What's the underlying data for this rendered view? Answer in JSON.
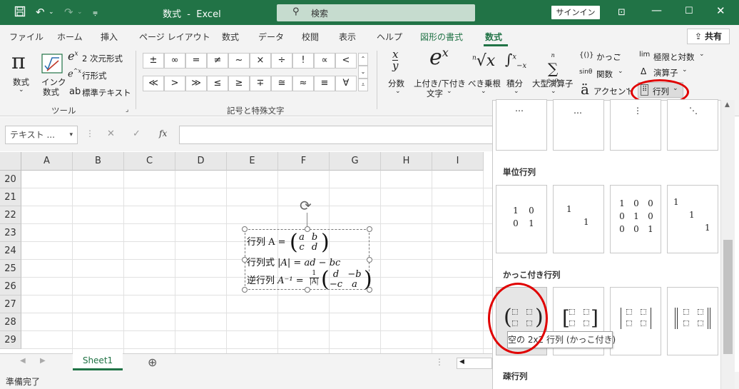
{
  "titlebar": {
    "doc_title": "数式",
    "title_sep": "-",
    "app_name": "Excel",
    "search_placeholder": "検索",
    "signin_label": "サインイン"
  },
  "tabs": [
    "ファイル",
    "ホーム",
    "挿入",
    "ページ レイアウト",
    "数式",
    "データ",
    "校閲",
    "表示",
    "ヘルプ",
    "図形の書式",
    "数式"
  ],
  "share_label": "共有",
  "ribbon": {
    "tools": {
      "equation_label": "数式",
      "ink_label_1": "インク",
      "ink_label_2": "数式",
      "prof_label": "2 次元形式",
      "linear_label": "行形式",
      "normal_label": "標準テキスト",
      "group_label": "ツール"
    },
    "symbols": {
      "row1": [
        "±",
        "∞",
        "=",
        "≠",
        "~",
        "×",
        "÷",
        "!",
        "∝",
        "<"
      ],
      "row2": [
        "≪",
        ">",
        "≫",
        "≤",
        "≥",
        "∓",
        "≅",
        "≈",
        "≡",
        "∀"
      ],
      "group_label": "記号と特殊文字"
    },
    "structures": {
      "fraction": "分数",
      "script_1": "上付き/下付き",
      "script_2": "文字",
      "radical": "べき乗根",
      "integral": "積分",
      "large_op": "大型演算子",
      "bracket": "かっこ",
      "function": "関数",
      "accent": "アクセント",
      "limit": "極限と対数",
      "operator": "演算子",
      "matrix": "行列"
    }
  },
  "formula_bar": {
    "name_box": "テキスト ...",
    "cancel": "✕",
    "enter": "✓",
    "fx": "fx"
  },
  "columns": [
    "A",
    "B",
    "C",
    "D",
    "E",
    "F",
    "G",
    "H",
    "I"
  ],
  "rows": [
    "20",
    "21",
    "22",
    "23",
    "24",
    "25",
    "26",
    "27",
    "28",
    "29"
  ],
  "equations": {
    "line1": "行列 A =",
    "line2_label": "行列式",
    "line2_expr": "|A| = ad − bc",
    "line3_label": "逆行列",
    "line3_expr": "A⁻¹ =",
    "m1": [
      "a",
      "b",
      "c",
      "d"
    ],
    "m2": [
      "d",
      "−b",
      "−c",
      "a"
    ],
    "frac_num": "1",
    "frac_den": "|A|"
  },
  "sheet": {
    "tab": "Sheet1"
  },
  "status": "準備完了",
  "gallery": {
    "sections": [
      "単位行列",
      "かっこ付き行列",
      "疎行列"
    ],
    "dots": [
      "⋯",
      "…",
      "⋮",
      "⋱"
    ],
    "identity_2x2": [
      "1",
      "0",
      "0",
      "1"
    ],
    "identity_3x3": [
      "1",
      "0",
      "0",
      "0",
      "1",
      "0",
      "0",
      "0",
      "1"
    ],
    "diag_2": [
      "1",
      "1"
    ],
    "diag_3": [
      "1",
      "1",
      "1"
    ],
    "tooltip": "空の 2x2 行列 (かっこ付き)"
  },
  "colors": {
    "brand": "#217346",
    "highlight": "#e00000"
  }
}
